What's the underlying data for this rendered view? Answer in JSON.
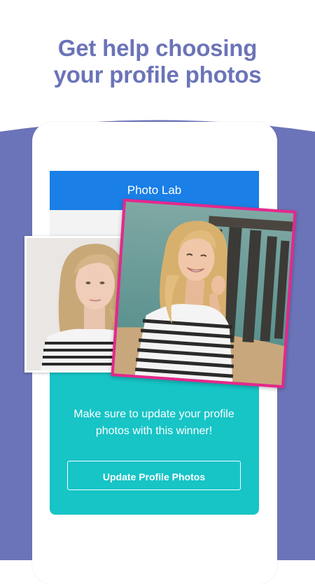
{
  "headline": {
    "line1": "Get help choosing",
    "line2": "your profile photos"
  },
  "app": {
    "header_title": "Photo Lab",
    "winner_message": "Make sure to update your profile photos with this winner!",
    "update_button_label": "Update Profile Photos"
  },
  "colors": {
    "accent_purple": "#6b74b8",
    "header_blue": "#1a7fe6",
    "teal": "#17c4c6",
    "winner_frame_pink": "#e4288c"
  },
  "photos": [
    {
      "name": "candidate-photo-portrait",
      "selected": false
    },
    {
      "name": "winner-photo-beach",
      "selected": true
    }
  ]
}
